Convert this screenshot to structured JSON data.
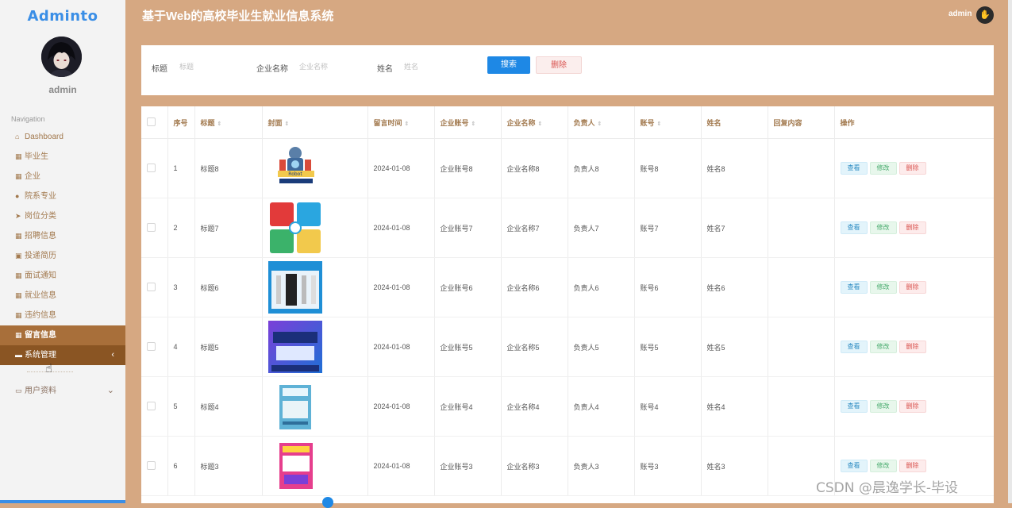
{
  "app": {
    "logo": "Adminto",
    "title": "基于Web的高校毕业生就业信息系统",
    "user": "admin"
  },
  "sidebar": {
    "username": "admin",
    "nav_title": "Navigation",
    "items": [
      {
        "label": "Dashboard",
        "icon": "home-icon"
      },
      {
        "label": "毕业生",
        "icon": "grid-icon"
      },
      {
        "label": "企业",
        "icon": "grid-icon"
      },
      {
        "label": "院系专业",
        "icon": "pin-icon"
      },
      {
        "label": "岗位分类",
        "icon": "send-icon"
      },
      {
        "label": "招聘信息",
        "icon": "grid-icon"
      },
      {
        "label": "投递简历",
        "icon": "briefcase-icon"
      },
      {
        "label": "面试通知",
        "icon": "grid-icon"
      },
      {
        "label": "就业信息",
        "icon": "grid-icon"
      },
      {
        "label": "违约信息",
        "icon": "grid-icon"
      },
      {
        "label": "留言信息",
        "icon": "grid-icon"
      },
      {
        "label": "系统管理",
        "icon": "monitor-icon"
      },
      {
        "label": "用户资料",
        "icon": "card-icon"
      }
    ]
  },
  "search": {
    "title_label": "标题",
    "title_placeholder": "标题",
    "company_label": "企业名称",
    "company_placeholder": "企业名称",
    "name_label": "姓名",
    "name_placeholder": "姓名",
    "search_button": "搜索",
    "delete_button": "删除"
  },
  "table": {
    "columns": [
      "序号",
      "标题",
      "封面",
      "留言时间",
      "企业账号",
      "企业名称",
      "负责人",
      "账号",
      "姓名",
      "回复内容",
      "操作"
    ],
    "rows": [
      {
        "no": "1",
        "title": "标题8",
        "cover": "robot",
        "time": "2024-01-08",
        "account": "企业账号8",
        "company": "企业名称8",
        "manager": "负责人8",
        "user": "账号8",
        "name": "姓名8",
        "reply": ""
      },
      {
        "no": "2",
        "title": "标题7",
        "cover": "tongcheng",
        "time": "2024-01-08",
        "account": "企业账号7",
        "company": "企业名称7",
        "manager": "负责人7",
        "user": "账号7",
        "name": "姓名7",
        "reply": ""
      },
      {
        "no": "3",
        "title": "标题6",
        "cover": "cables",
        "time": "2024-01-08",
        "account": "企业账号6",
        "company": "企业名称6",
        "manager": "负责人6",
        "user": "账号6",
        "name": "姓名6",
        "reply": ""
      },
      {
        "no": "4",
        "title": "标题5",
        "cover": "programming",
        "time": "2024-01-08",
        "account": "企业账号5",
        "company": "企业名称5",
        "manager": "负责人5",
        "user": "账号5",
        "name": "姓名5",
        "reply": ""
      },
      {
        "no": "5",
        "title": "标题4",
        "cover": "book-blue",
        "time": "2024-01-08",
        "account": "企业账号4",
        "company": "企业名称4",
        "manager": "负责人4",
        "user": "账号4",
        "name": "姓名4",
        "reply": ""
      },
      {
        "no": "6",
        "title": "标题3",
        "cover": "book-pink",
        "time": "2024-01-08",
        "account": "企业账号3",
        "company": "企业名称3",
        "manager": "负责人3",
        "user": "账号3",
        "name": "姓名3",
        "reply": ""
      }
    ],
    "actions": {
      "view": "查看",
      "edit": "修改",
      "delete": "删除"
    }
  },
  "watermark": "CSDN @晨逸学长-毕设",
  "colors": {
    "brand": "#d6a882",
    "active": "#a86f3a",
    "primary": "#1e88e5",
    "danger": "#d9534f",
    "success": "#44a96a"
  }
}
